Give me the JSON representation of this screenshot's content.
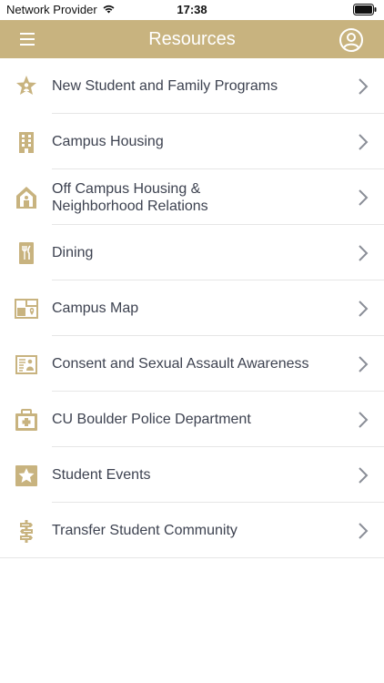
{
  "status": {
    "carrier": "Network Provider",
    "time": "17:38"
  },
  "header": {
    "title": "Resources"
  },
  "colors": {
    "accent": "#c8b37f",
    "icon": "#c8b37f",
    "chevron": "#8a8e97"
  },
  "items": [
    {
      "label": "New Student and Family Programs",
      "icon": "star-person-icon"
    },
    {
      "label": "Campus Housing",
      "icon": "building-icon"
    },
    {
      "label": "Off Campus Housing &\nNeighborhood Relations",
      "icon": "house-icon"
    },
    {
      "label": "Dining",
      "icon": "utensils-icon"
    },
    {
      "label": "Campus Map",
      "icon": "map-icon"
    },
    {
      "label": "Consent and Sexual Assault Awareness",
      "icon": "people-board-icon"
    },
    {
      "label": "CU Boulder Police Department",
      "icon": "first-aid-icon"
    },
    {
      "label": "Student Events",
      "icon": "star-icon"
    },
    {
      "label": "Transfer Student Community",
      "icon": "signpost-icon"
    }
  ]
}
